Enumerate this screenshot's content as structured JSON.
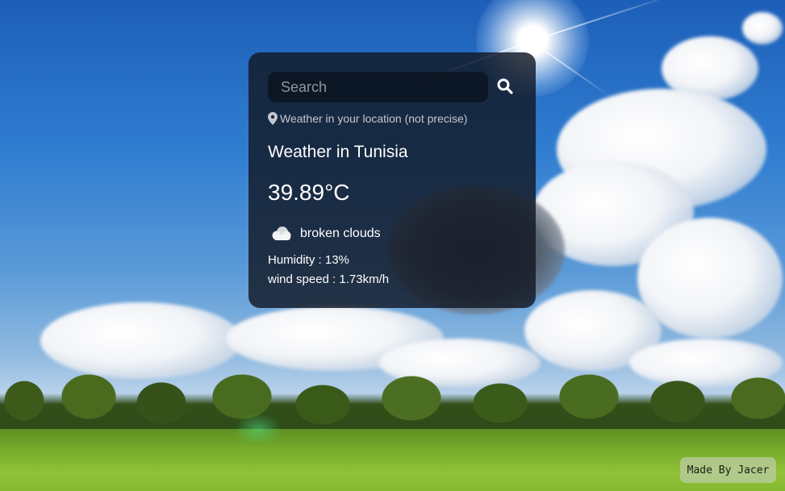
{
  "search": {
    "placeholder": "Search",
    "value": ""
  },
  "location_note": "Weather in your location (not precise)",
  "weather": {
    "city_line": "Weather in Tunisia",
    "temperature": "39.89°C",
    "description": "broken clouds",
    "icon": "broken-clouds-icon",
    "humidity_line": "Humidity : 13%",
    "wind_line": "wind speed : 1.73km/h"
  },
  "footer": {
    "credit": "Made By Jacer"
  }
}
